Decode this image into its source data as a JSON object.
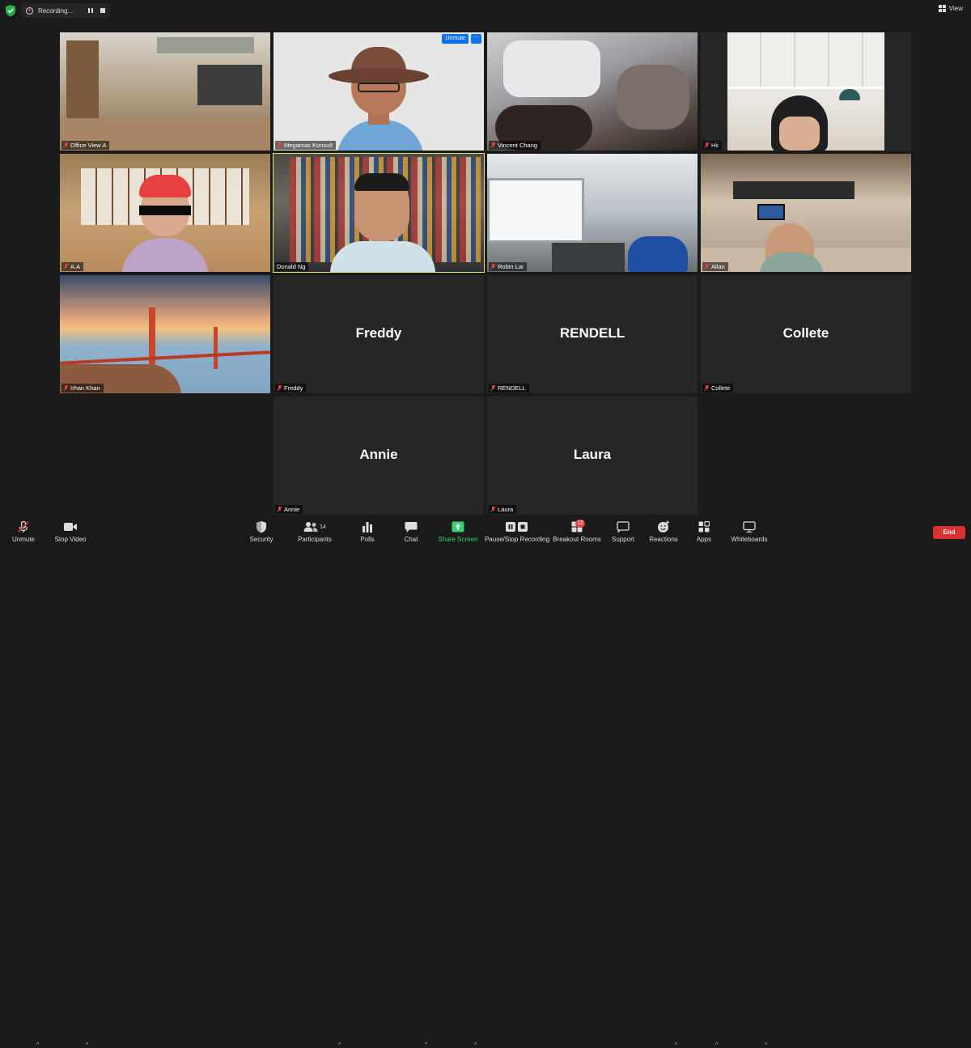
{
  "top_bar": {
    "recording_label": "Recording...",
    "view_label": "View"
  },
  "tiles": [
    {
      "name": "Office View A",
      "muted": true,
      "video": "office"
    },
    {
      "name": "Megamas Konsult",
      "muted": true,
      "video": "avatar-hat",
      "unmute_label": "Unmute",
      "more_label": "···"
    },
    {
      "name": "Vincent Chang",
      "muted": true,
      "video": "blurred"
    },
    {
      "name": "Hii",
      "muted": true,
      "video": "room"
    },
    {
      "name": "A.A",
      "muted": true,
      "video": "avatar-red-hair"
    },
    {
      "name": "Donald Ng",
      "muted": false,
      "active_speaker": true,
      "video": "bookshelf"
    },
    {
      "name": "Robin Lai",
      "muted": true,
      "video": "office2"
    },
    {
      "name": "Allan",
      "muted": true,
      "video": "living-room"
    },
    {
      "name": "Irhan Khan",
      "muted": true,
      "video": "golden-gate-bridge"
    },
    {
      "name": "Freddy",
      "display_name": "Freddy",
      "muted": true,
      "video": "none"
    },
    {
      "name": "RENDELL",
      "display_name": "RENDELL",
      "muted": true,
      "video": "none"
    },
    {
      "name": "Collete",
      "display_name": "Collete",
      "muted": true,
      "video": "none"
    },
    {
      "name": "Annie",
      "display_name": "Annie",
      "muted": true,
      "video": "none"
    },
    {
      "name": "Laura",
      "display_name": "Laura",
      "muted": true,
      "video": "none"
    }
  ],
  "toolbar": {
    "unmute": "Unmute",
    "stop_video": "Stop Video",
    "security": "Security",
    "participants": "Participants",
    "participants_count": "14",
    "polls": "Polls",
    "chat": "Chat",
    "share_screen": "Share Screen",
    "pause_stop_recording": "Pause/Stop Recording",
    "breakout_rooms": "Breakout Rooms",
    "breakout_badge": "12",
    "support": "Support",
    "reactions": "Reactions",
    "apps": "Apps",
    "whiteboards": "Whiteboards",
    "end": "End"
  },
  "colors": {
    "background": "#1a1a1a",
    "tile_background": "#262626",
    "active_speaker_border": "#e9e56a",
    "share_green": "#35d26c",
    "end_red": "#d93030",
    "unmute_chip_blue": "#0e72ed",
    "muted_red": "#e04545"
  }
}
